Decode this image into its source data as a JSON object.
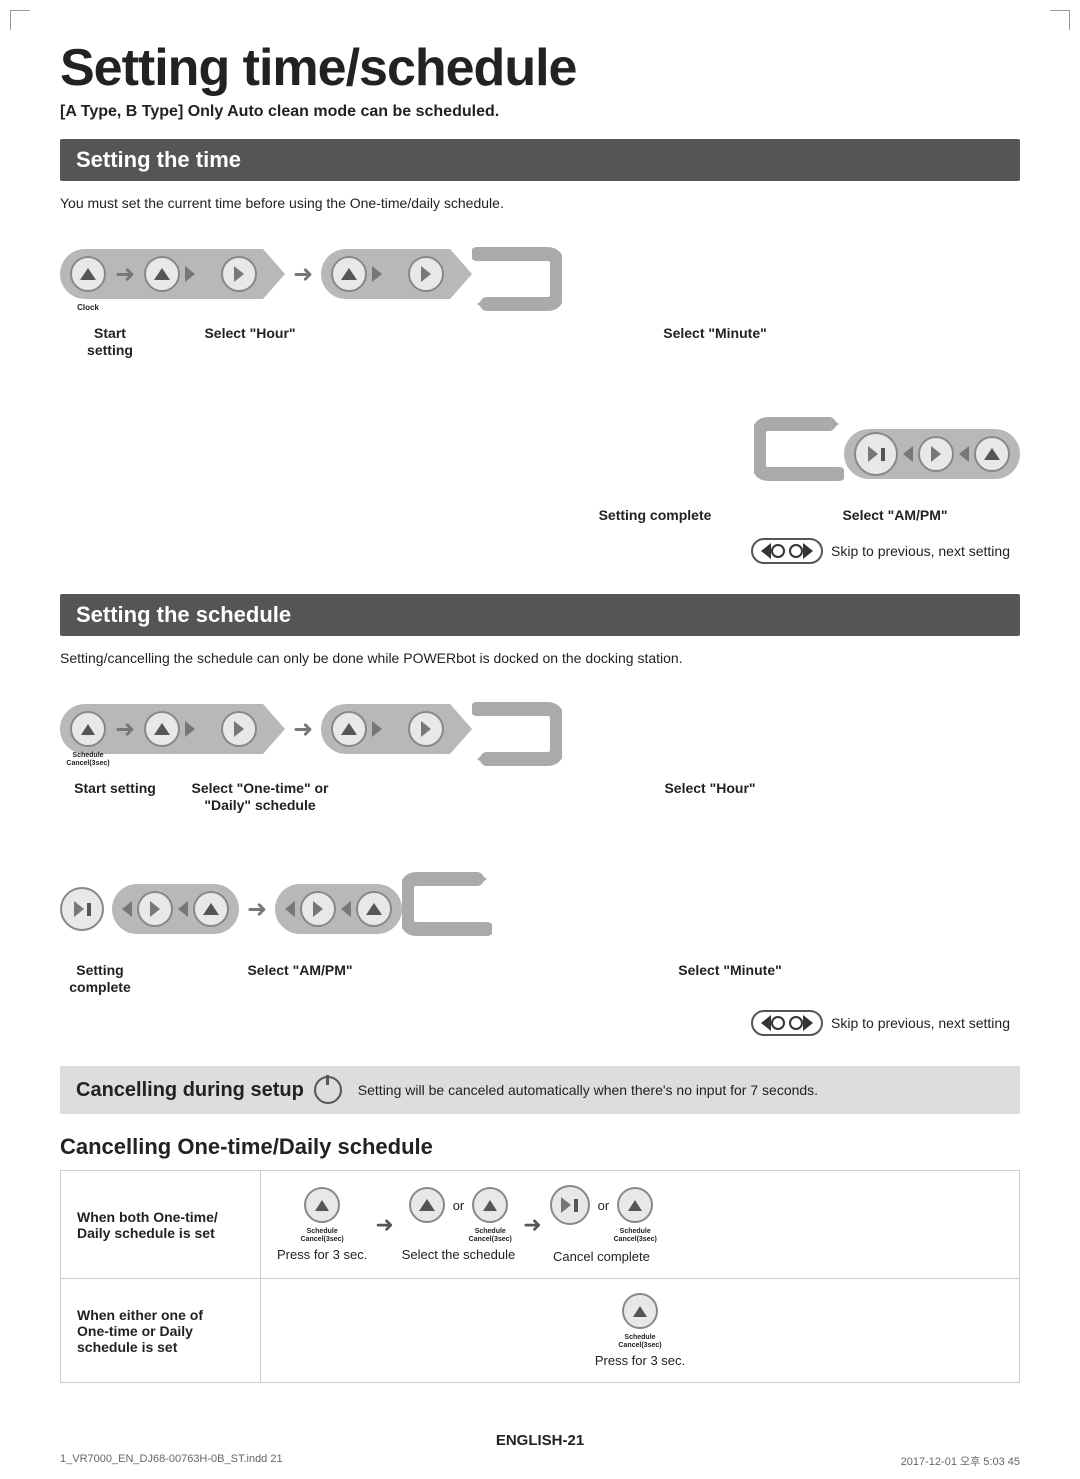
{
  "page": {
    "title": "Setting time/schedule",
    "subtitle": "[A Type, B Type] Only Auto clean mode can be scheduled.",
    "footer": "ENGLISH-21",
    "footer_meta_left": "1_VR7000_EN_DJ68-00763H-0B_ST.indd  21",
    "footer_meta_right": "2017-12-01  오후 5:03  45"
  },
  "setting_time": {
    "header": "Setting the time",
    "note": "You must set the current time before using the One-time/daily schedule.",
    "row1_labels": {
      "start": "Start setting",
      "select_hour": "Select \"Hour\"",
      "select_minute": "Select \"Minute\""
    },
    "row2_labels": {
      "setting_complete": "Setting complete",
      "select_ampm": "Select \"AM/PM\"",
      "skip": "Skip to previous, next setting"
    },
    "clock_label": "Clock"
  },
  "setting_schedule": {
    "header": "Setting the schedule",
    "note": "Setting/cancelling the schedule can only be done while POWERbot is docked on the docking station.",
    "row1_labels": {
      "start": "Start setting",
      "select_onetime_daily": "Select \"One-time\" or\n\"Daily\" schedule",
      "select_hour": "Select \"Hour\""
    },
    "row2_labels": {
      "setting_complete": "Setting complete",
      "select_ampm": "Select \"AM/PM\"",
      "select_minute": "Select \"Minute\"",
      "skip": "Skip to previous, next setting"
    },
    "schedule_label": "Schedule\nCancel(3sec)"
  },
  "cancelling_setup": {
    "header": "Cancelling during setup",
    "note": "Setting will be canceled automatically when there's no input for 7 seconds."
  },
  "cancelling_onetime": {
    "header": "Cancelling One-time/Daily schedule",
    "rows": [
      {
        "condition": "When both One-time/\nDaily schedule is set",
        "step1_label": "Schedule\nCancel(3sec)",
        "step1_note": "Press for 3 sec.",
        "step2_label": "Schedule\nCancel(3sec)",
        "step2_note": "Select the schedule",
        "step3_label": "Schedule\nCancel(3sec)",
        "step3_note": "Cancel complete"
      },
      {
        "condition": "When either one of\nOne-time or Daily\nschedule is set",
        "step1_label": "Schedule\nCancel(3sec)",
        "step1_note": "Press for 3 sec."
      }
    ]
  }
}
